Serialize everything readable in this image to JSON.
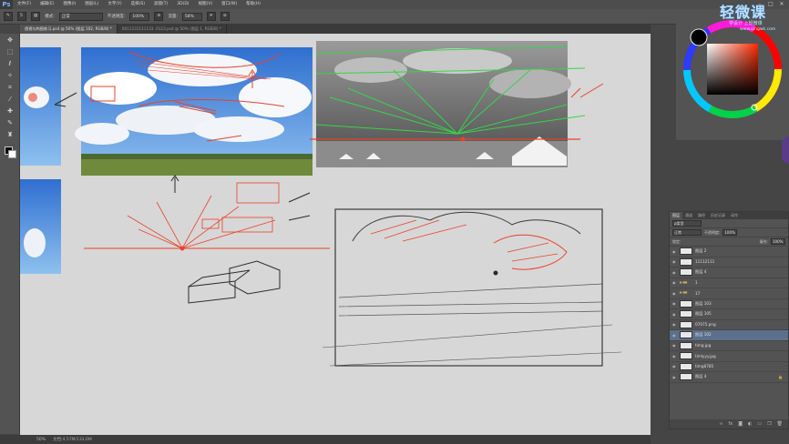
{
  "app": {
    "logo": "Ps"
  },
  "menu": [
    "文件(F)",
    "编辑(E)",
    "图像(I)",
    "图层(L)",
    "文字(Y)",
    "选择(S)",
    "滤镜(T)",
    "3D(D)",
    "视图(V)",
    "窗口(W)",
    "帮助(H)"
  ],
  "window_controls": [
    "–",
    "□",
    "✕"
  ],
  "options": {
    "brush_size": "5",
    "mode_label": "模式:",
    "mode_value": "正常",
    "opacity_label": "不透明度:",
    "opacity_value": "100%",
    "flow_label": "流量:",
    "flow_value": "58%"
  },
  "tabs": [
    {
      "label": "透视与构图练习.psd @ 50% (图层 102, RGB/8) *",
      "active": true
    },
    {
      "label": "0011231111133..0123.psd @ 50% (图层 1, RGB/8) *",
      "active": false
    }
  ],
  "status": {
    "zoom": "50%",
    "doc": "文档:4.57M/133.6M"
  },
  "watermark": {
    "title": "轻微课",
    "sub": "学设计 上轻微课",
    "url": "www.qingwk.com"
  },
  "colors": {
    "accent_red": "#e8432a",
    "accent_green": "#39d34a",
    "canvas_bg": "#d7d7d7",
    "sketch": "#2a2a2a"
  },
  "layers": {
    "tabs": [
      "图层",
      "通道",
      "路径",
      "历史记录",
      "动作"
    ],
    "kind_label": "ρ类型",
    "blend": "正常",
    "opacity_label": "不透明度:",
    "opacity": "100%",
    "lock_label": "锁定:",
    "fill_label": "填充:",
    "fill": "100%",
    "items": [
      {
        "name": "图层 2",
        "type": "layer",
        "selected": false
      },
      {
        "name": "11112111",
        "type": "layer",
        "selected": false
      },
      {
        "name": "图层 4",
        "type": "layer",
        "selected": false
      },
      {
        "name": "1",
        "type": "folder",
        "selected": false
      },
      {
        "name": "17",
        "type": "folder",
        "selected": false
      },
      {
        "name": "图层 103",
        "type": "layer",
        "selected": false
      },
      {
        "name": "图层 105",
        "type": "layer",
        "selected": false
      },
      {
        "name": "07075.png",
        "type": "layer",
        "selected": false
      },
      {
        "name": "图层 102",
        "type": "layer",
        "selected": true
      },
      {
        "name": "timg.jpg",
        "type": "layer",
        "selected": false
      },
      {
        "name": "timlyyy.jpg",
        "type": "layer",
        "selected": false
      },
      {
        "name": "timg8785",
        "type": "layer",
        "selected": false
      },
      {
        "name": "图层 4",
        "type": "layer",
        "selected": false,
        "locked": true
      }
    ],
    "footer_icons": [
      "link-icon",
      "fx-icon",
      "mask-icon",
      "adjustment-icon",
      "folder-icon",
      "new-layer-icon",
      "trash-icon"
    ]
  }
}
